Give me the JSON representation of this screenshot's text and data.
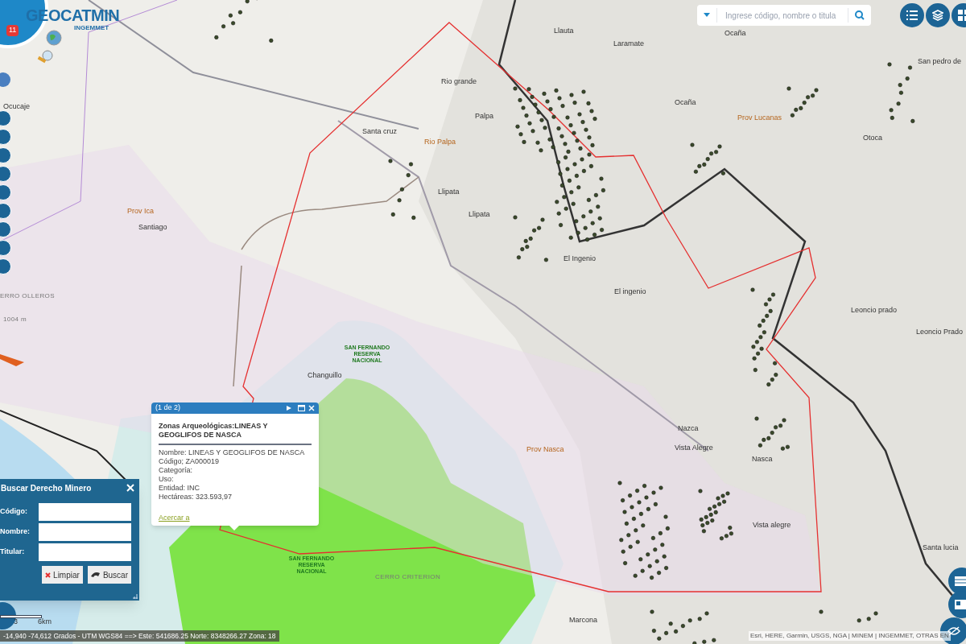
{
  "app": {
    "title": "GEOCATMIN",
    "subtitle": "INGEMMET",
    "notification_count": "11"
  },
  "search": {
    "placeholder": "Ingrese código, nombre o titula"
  },
  "map_labels": [
    {
      "text": "Llauta",
      "kind": "place"
    },
    {
      "text": "Laramate",
      "kind": "place"
    },
    {
      "text": "Ocaña",
      "kind": "place"
    },
    {
      "text": "San pedro de",
      "kind": "place"
    },
    {
      "text": "Rio grande",
      "kind": "place"
    },
    {
      "text": "Ocucaje",
      "kind": "place"
    },
    {
      "text": "Santa cruz",
      "kind": "place"
    },
    {
      "text": "Palpa",
      "kind": "place"
    },
    {
      "text": "Rio Palpa",
      "kind": "province"
    },
    {
      "text": "Ocaña",
      "kind": "place"
    },
    {
      "text": "Prov Lucanas",
      "kind": "province"
    },
    {
      "text": "Otoca",
      "kind": "place"
    },
    {
      "text": "Llipata",
      "kind": "place"
    },
    {
      "text": "Llipata",
      "kind": "place"
    },
    {
      "text": "Prov Ica",
      "kind": "province"
    },
    {
      "text": "Santiago",
      "kind": "place"
    },
    {
      "text": "El Ingenio",
      "kind": "place"
    },
    {
      "text": "El ingenio",
      "kind": "place"
    },
    {
      "text": "Leoncio prado",
      "kind": "place"
    },
    {
      "text": "Leoncio Prado",
      "kind": "place"
    },
    {
      "text": "ERRO OLLEROS",
      "kind": "feature"
    },
    {
      "text": "1004 m",
      "kind": "feature"
    },
    {
      "text": "SAN FERNANDO RESERVA NACIONAL",
      "kind": "reserve"
    },
    {
      "text": "Changuillo",
      "kind": "place"
    },
    {
      "text": "Nazca",
      "kind": "place"
    },
    {
      "text": "Vista Alegre",
      "kind": "place"
    },
    {
      "text": "Prov Nasca",
      "kind": "province"
    },
    {
      "text": "Nasca",
      "kind": "place"
    },
    {
      "text": "Vista alegre",
      "kind": "place"
    },
    {
      "text": "Santa lucia",
      "kind": "place"
    },
    {
      "text": "SAN FERNANDO RESERVA NACIONAL",
      "kind": "reserve"
    },
    {
      "text": "CERRO CRITERION",
      "kind": "feature"
    },
    {
      "text": "Marcona",
      "kind": "place"
    }
  ],
  "popup": {
    "pager": "(1 de 2)",
    "title": "Zonas Arqueológicas:LINEAS Y GEOGLIFOS DE NASCA",
    "fields": [
      "Nombre: LINEAS Y GEOGLIFOS DE NASCA",
      "Código; ZA000019",
      "Categoría:",
      "Uso:",
      "Entidad: INC",
      "Hectáreas: 323.593,97"
    ],
    "link": "Acercar a"
  },
  "search_dialog": {
    "title": "Buscar Derecho Minero",
    "fields": [
      {
        "label": "Código:"
      },
      {
        "label": "Nombre:"
      },
      {
        "label": "Titular:"
      }
    ],
    "buttons": [
      {
        "label": "Limpiar",
        "kind": "clear"
      },
      {
        "label": "Buscar",
        "kind": "search"
      }
    ]
  },
  "scale": {
    "labels": [
      "3",
      "6km"
    ]
  },
  "coordinates": "-14,940 -74,612 Grados - UTM WGS84 ==> Este: 541686.25 Norte: 8348266.27 Zona: 18",
  "attribution": "Esri, HERE, Garmin, USGS, NGA | MINEM | INGEMMET, OTRAS EN"
}
